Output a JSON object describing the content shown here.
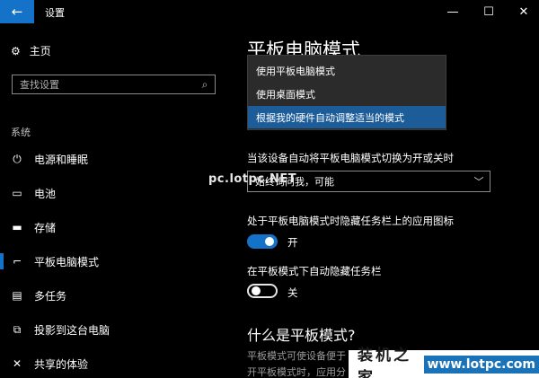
{
  "window": {
    "title": "设置",
    "back_icon": "←",
    "minimize_icon": "—",
    "maximize_icon": "☐",
    "close_icon": "✕"
  },
  "sidebar": {
    "home_icon": "⚙",
    "home_label": "主页",
    "search_placeholder": "查找设置",
    "search_icon": "⌕",
    "section_label": "系统",
    "items": [
      {
        "icon": "⏻",
        "label": "电源和睡眠"
      },
      {
        "icon": "▭",
        "label": "电池"
      },
      {
        "icon": "▬",
        "label": "存储"
      },
      {
        "icon": "⌐",
        "label": "平板电脑模式"
      },
      {
        "icon": "▤",
        "label": "多任务"
      },
      {
        "icon": "⧉",
        "label": "投影到这台电脑"
      },
      {
        "icon": "✕",
        "label": "共享的体验"
      }
    ],
    "active_index": 3
  },
  "main": {
    "title": "平板电脑模式",
    "dropdown_options": [
      "使用平板电脑模式",
      "使用桌面模式",
      "根据我的硬件自动调整适当的模式"
    ],
    "dropdown_selected_index": 2,
    "switch_label": "当该设备自动将平板电脑模式切换为开或关时",
    "switch_select_value": "始终询问我，可能",
    "chevron_icon": "﹀",
    "hide_icons_label": "处于平板电脑模式时隐藏任务栏上的应用图标",
    "hide_icons_state": "开",
    "hide_icons_on": true,
    "auto_hide_label": "在平板模式下自动隐藏任务栏",
    "auto_hide_state": "关",
    "auto_hide_on": false,
    "section_heading": "什么是平板模式?",
    "description_lines": [
      "平板模式可使设备便于",
      "开平板模式时，应用分"
    ]
  },
  "watermarks": {
    "middle": "pc.lotpc.NET",
    "corner_cn": "装机之家",
    "corner_url": "www.lotpc.com"
  },
  "colors": {
    "accent": "#1473c8",
    "dropdown_selected": "#1c5c99",
    "background": "#000000"
  }
}
